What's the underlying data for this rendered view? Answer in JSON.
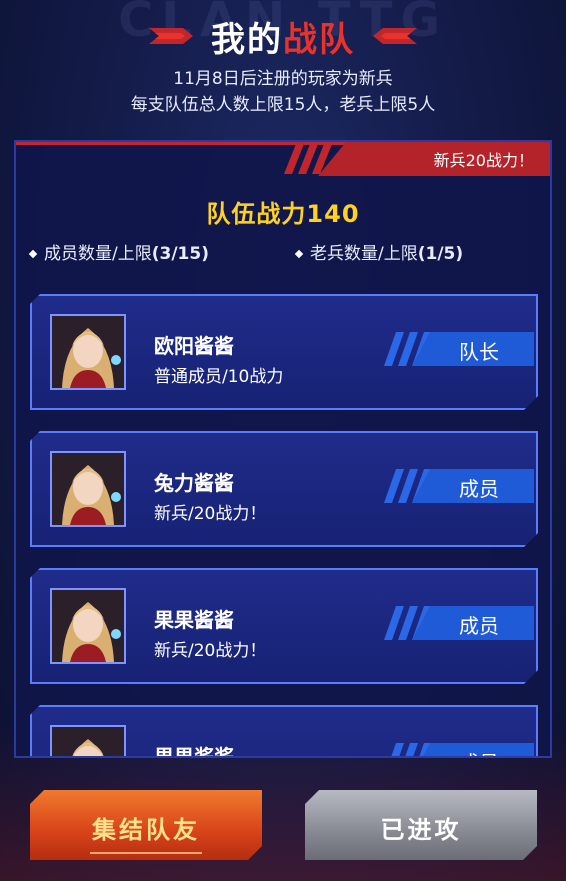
{
  "header": {
    "bg_text": "CLAN TTG",
    "title_white": "我的",
    "title_red": "战队",
    "subtitle_1": "11月8日后注册的玩家为新兵",
    "subtitle_2": "每支队伍总人数上限15人，老兵上限5人"
  },
  "panel": {
    "banner": "新兵20战力！",
    "team_power": "队伍战力140",
    "members_label": "成员数量/上限",
    "members_value": "(3/15)",
    "veterans_label": "老兵数量/上限",
    "veterans_value": "(1/5)"
  },
  "members": [
    {
      "name": "欧阳酱酱",
      "desc": "普通成员/10战力",
      "role": "队长"
    },
    {
      "name": "兔力酱酱",
      "desc": "新兵/20战力！",
      "role": "成员"
    },
    {
      "name": "果果酱酱",
      "desc": "新兵/20战力！",
      "role": "成员"
    },
    {
      "name": "果果酱酱",
      "desc": "",
      "role": "成员"
    }
  ],
  "buttons": {
    "gather": "集结队友",
    "attacked": "已进攻"
  },
  "colors": {
    "accent_red": "#e8322a",
    "gold": "#ffd21f",
    "role_blue": "#1f5bd6",
    "card_border": "#5a7dff"
  }
}
